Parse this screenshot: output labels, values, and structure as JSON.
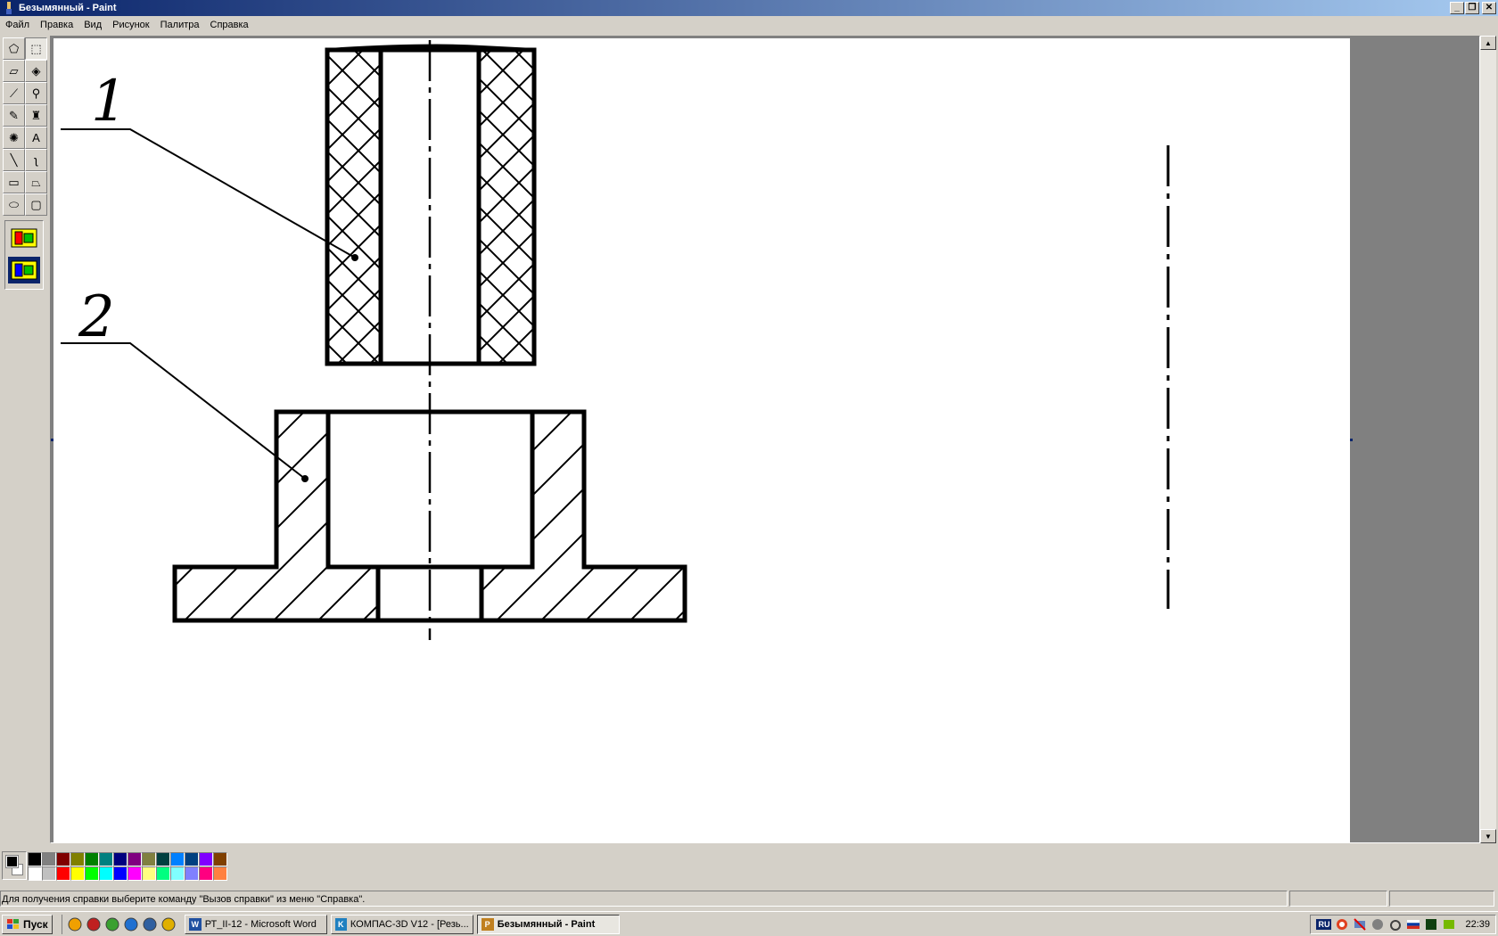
{
  "window": {
    "title": "Безымянный - Paint",
    "buttons": [
      "_",
      "❐",
      "✕"
    ]
  },
  "menu": [
    "Файл",
    "Правка",
    "Вид",
    "Рисунок",
    "Палитра",
    "Справка"
  ],
  "tools": [
    {
      "name": "free-select-tool",
      "glyph": "⬠"
    },
    {
      "name": "rect-select-tool",
      "glyph": "⬚"
    },
    {
      "name": "eraser-tool",
      "glyph": "▱"
    },
    {
      "name": "fill-tool",
      "glyph": "◈"
    },
    {
      "name": "color-picker-tool",
      "glyph": "⟋"
    },
    {
      "name": "magnifier-tool",
      "glyph": "⚲"
    },
    {
      "name": "pencil-tool",
      "glyph": "✎"
    },
    {
      "name": "brush-tool",
      "glyph": "♜"
    },
    {
      "name": "airbrush-tool",
      "glyph": "✺"
    },
    {
      "name": "text-tool",
      "glyph": "A"
    },
    {
      "name": "line-tool",
      "glyph": "╲"
    },
    {
      "name": "curve-tool",
      "glyph": "ʅ"
    },
    {
      "name": "rectangle-tool",
      "glyph": "▭"
    },
    {
      "name": "polygon-tool",
      "glyph": "⏢"
    },
    {
      "name": "ellipse-tool",
      "glyph": "⬭"
    },
    {
      "name": "rounded-rect-tool",
      "glyph": "▢"
    }
  ],
  "colors": {
    "foreground": "#000000",
    "background": "#ffffff",
    "title_start": "#0a246a",
    "title_end": "#a6caf0",
    "palette": [
      "#000000",
      "#808080",
      "#800000",
      "#808000",
      "#008000",
      "#008080",
      "#000080",
      "#800080",
      "#808040",
      "#004040",
      "#0080ff",
      "#004080",
      "#8000ff",
      "#804000",
      "#ffffff",
      "#c0c0c0",
      "#ff0000",
      "#ffff00",
      "#00ff00",
      "#00ffff",
      "#0000ff",
      "#ff00ff",
      "#ffff80",
      "#00ff80",
      "#80ffff",
      "#8080ff",
      "#ff0080",
      "#ff8040"
    ]
  },
  "drawing": {
    "label_1": "1",
    "label_2": "2"
  },
  "status": {
    "message": "Для получения справки выберите команду \"Вызов справки\" из меню \"Справка\"."
  },
  "taskbar": {
    "start_label": "Пуск",
    "quick_icons": [
      "media-player-icon",
      "opera-icon",
      "utorrent-icon",
      "ie-icon",
      "desktop-icon",
      "chrome-icon"
    ],
    "tasks": [
      {
        "label": "РТ_II-12 - Microsoft Word",
        "icon": "W",
        "active": false
      },
      {
        "label": "КОМПАС-3D V12 - [Резь...",
        "icon": "K",
        "active": false
      },
      {
        "label": "Безымянный - Paint",
        "icon": "P",
        "active": true
      }
    ],
    "language": "RU",
    "clock": "22:39"
  }
}
